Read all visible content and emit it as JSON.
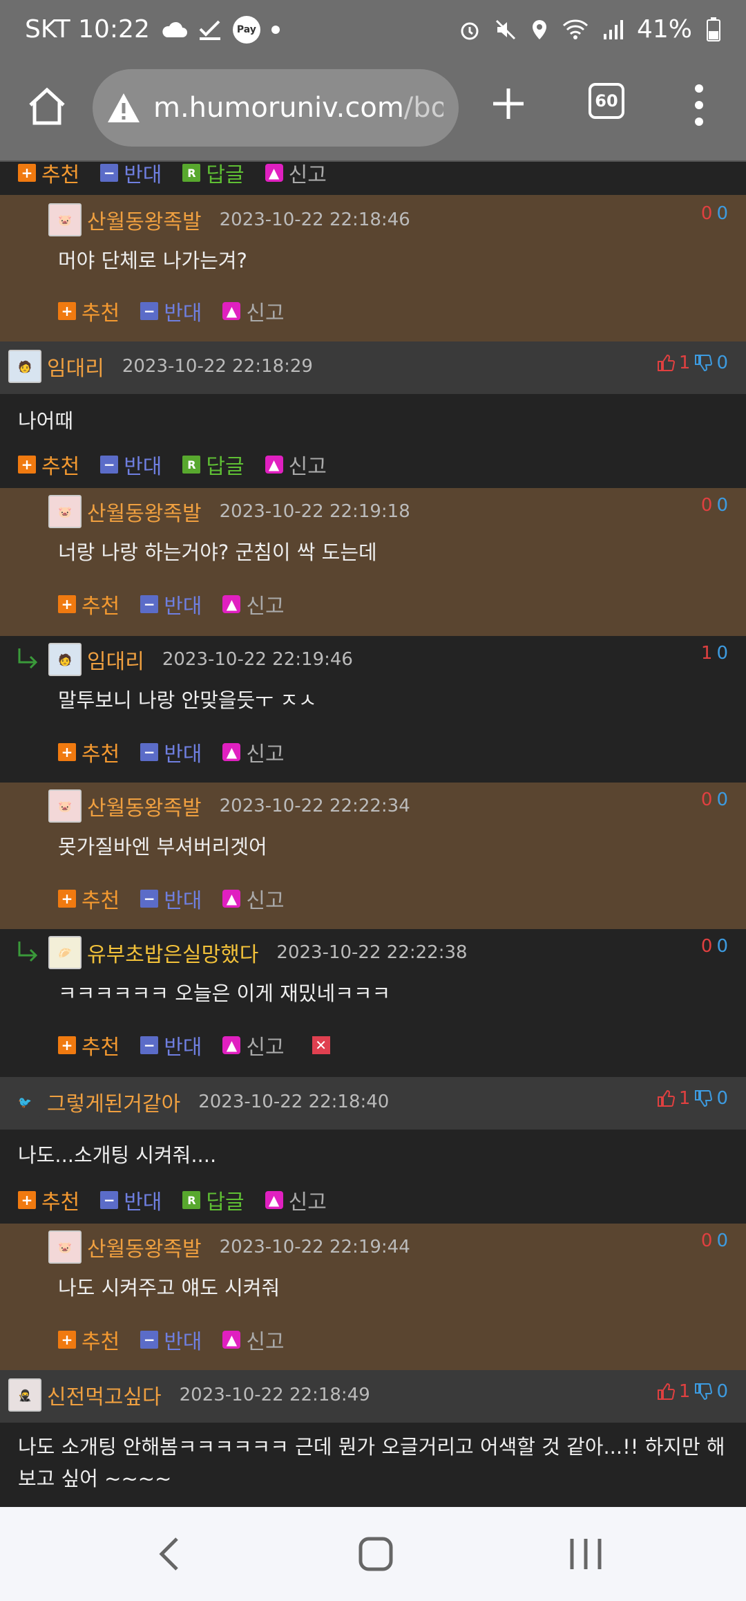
{
  "status": {
    "carrier_time": "SKT 10:22",
    "pay_label": "Pay",
    "battery": "41%"
  },
  "browser": {
    "url_host": "m.humoruniv.com",
    "url_path": "/boa",
    "tab_count": "60"
  },
  "labels": {
    "recommend": "추천",
    "oppose": "반대",
    "reply": "답글",
    "report": "신고"
  },
  "comments": [
    {
      "nick": "산월동왕족발",
      "time": "2023-10-22 22:18:46",
      "text": "머야 단체로 나가는겨?",
      "up": "0",
      "down": "0"
    },
    {
      "nick": "임대리",
      "time": "2023-10-22 22:18:29",
      "text": "나어때",
      "up": "1",
      "down": "0"
    },
    {
      "nick": "산월동왕족발",
      "time": "2023-10-22 22:19:18",
      "text": "너랑 나랑 하는거야? 군침이 싹 도는데",
      "up": "0",
      "down": "0"
    },
    {
      "nick": "임대리",
      "time": "2023-10-22 22:19:46",
      "text": "말투보니 나랑 안맞을듯ㅜ ㅈㅅ",
      "up": "1",
      "down": "0"
    },
    {
      "nick": "산월동왕족발",
      "time": "2023-10-22 22:22:34",
      "text": "못가질바엔 부셔버리겟어",
      "up": "0",
      "down": "0"
    },
    {
      "nick": "유부초밥은실망했다",
      "time": "2023-10-22 22:22:38",
      "text": "ㅋㅋㅋㅋㅋㅋ 오늘은 이게 재밌네ㅋㅋㅋ",
      "up": "0",
      "down": "0"
    },
    {
      "nick": "그렇게된거같아",
      "time": "2023-10-22 22:18:40",
      "text": "나도...소개팅 시켜줘....",
      "up": "1",
      "down": "0"
    },
    {
      "nick": "산월동왕족발",
      "time": "2023-10-22 22:19:44",
      "text": "나도 시켜주고 얘도 시켜줘",
      "up": "0",
      "down": "0"
    },
    {
      "nick": "신전먹고싶다",
      "time": "2023-10-22 22:18:49",
      "text": "나도 소개팅 안해봄ㅋㅋㅋㅋㅋㅋ 근데 뭔가 오글거리고 어색할 것 같아...!! 하지만 해보고 싶어 ~~~~",
      "up": "1",
      "down": "0"
    }
  ]
}
